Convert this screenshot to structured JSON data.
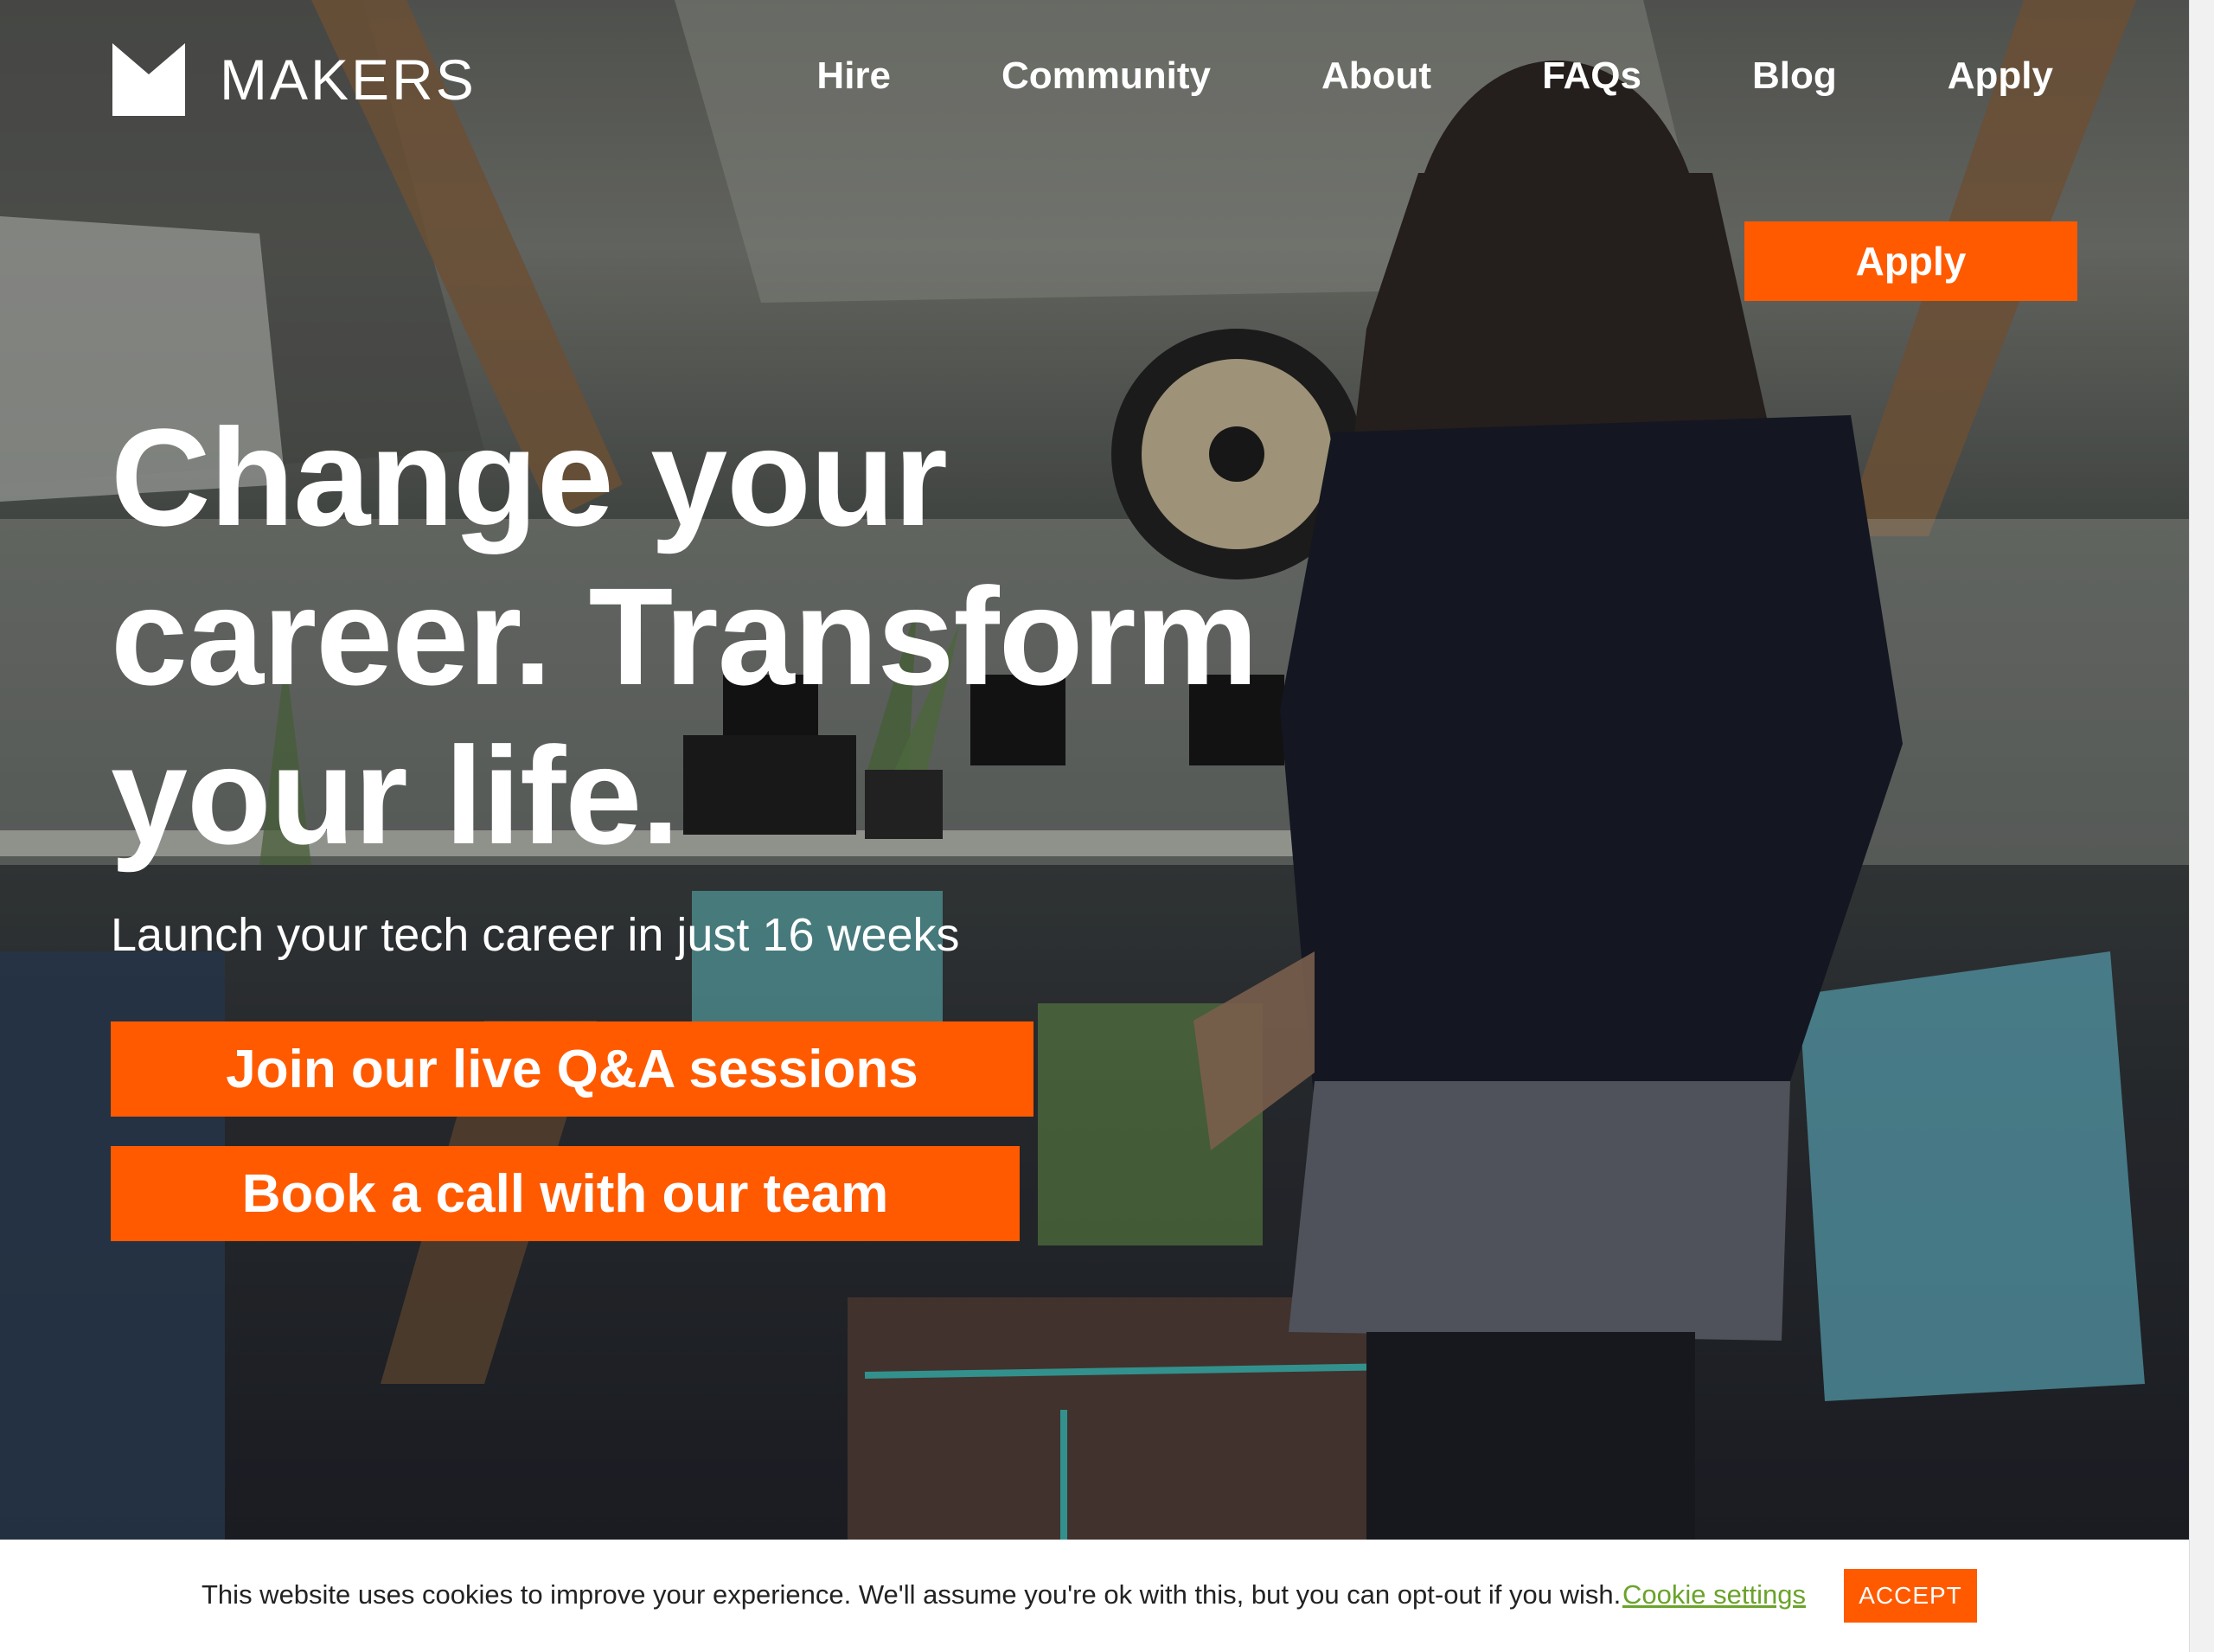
{
  "brand": {
    "name": "MAKERS",
    "accent_color": "#ff5a00"
  },
  "nav": {
    "items": [
      "Hire",
      "Community",
      "About",
      "FAQs",
      "Blog",
      "Apply"
    ]
  },
  "hero": {
    "apply_button": "Apply",
    "headline": "Change your career. Transform your life.",
    "subheadline": "Launch your tech career in just 16 weeks",
    "cta_primary": "Join our live Q&A sessions",
    "cta_secondary": "Book a call with our team"
  },
  "cookie": {
    "message": "This website uses cookies to improve your experience. We'll assume you're ok with this, but you can opt-out if you wish.",
    "settings_label": "Cookie settings",
    "accept_label": "ACCEPT"
  }
}
